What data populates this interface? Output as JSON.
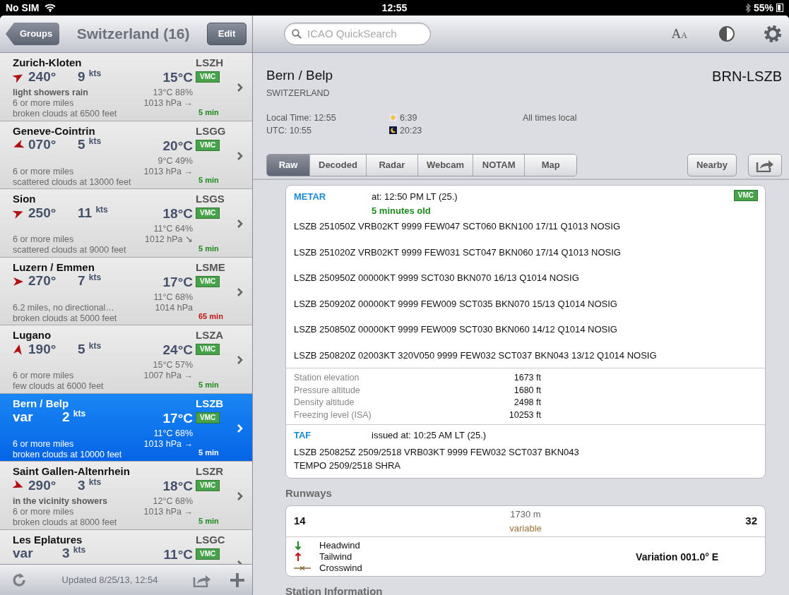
{
  "status_bar": {
    "carrier": "No SIM",
    "time": "12:55",
    "battery": "55%"
  },
  "sidebar": {
    "back_button": "Groups",
    "title": "Switzerland (16)",
    "edit_button": "Edit",
    "stations": [
      {
        "name": "Zurich-Kloten",
        "icao": "LSZH",
        "wind_dir": "240°",
        "speed": "9",
        "speed_unit": "kts",
        "temp": "15°C",
        "flight_rules": "VMC",
        "weather": "light showers rain",
        "dew_humidity": "13°C 88%",
        "visibility": "6 or more miles",
        "pressure": "1013 hPa →",
        "clouds": "broken clouds at 6500 feet",
        "age": "5 min",
        "age_stale": false,
        "selected": false
      },
      {
        "name": "Geneve-Cointrin",
        "icao": "LSGG",
        "wind_dir": "070°",
        "speed": "5",
        "speed_unit": "kts",
        "temp": "20°C",
        "flight_rules": "VMC",
        "dew_humidity": "9°C 49%",
        "visibility": "6 or more miles",
        "pressure": "1013 hPa →",
        "clouds": "scattered clouds at 13000 feet",
        "age": "5 min",
        "age_stale": false,
        "selected": false
      },
      {
        "name": "Sion",
        "icao": "LSGS",
        "wind_dir": "250°",
        "speed": "11",
        "speed_unit": "kts",
        "temp": "18°C",
        "flight_rules": "VMC",
        "dew_humidity": "11°C 64%",
        "visibility": "6 or more miles",
        "pressure": "1012 hPa ↘",
        "clouds": "scattered clouds at 9000 feet",
        "age": "5 min",
        "age_stale": false,
        "selected": false
      },
      {
        "name": "Luzern / Emmen",
        "icao": "LSME",
        "wind_dir": "270°",
        "speed": "7",
        "speed_unit": "kts",
        "temp": "17°C",
        "flight_rules": "VMC",
        "dew_humidity": "11°C 68%",
        "visibility": "6.2 miles, no directional…",
        "pressure": "1014 hPa",
        "clouds": "broken clouds at 5000 feet",
        "age": "65 min",
        "age_stale": true,
        "selected": false
      },
      {
        "name": "Lugano",
        "icao": "LSZA",
        "wind_dir": "190°",
        "speed": "5",
        "speed_unit": "kts",
        "temp": "24°C",
        "flight_rules": "VMC",
        "dew_humidity": "15°C 57%",
        "visibility": "6 or more miles",
        "pressure": "1007 hPa →",
        "clouds": "few clouds at 6000 feet",
        "age": "5 min",
        "age_stale": false,
        "selected": false
      },
      {
        "name": "Bern / Belp",
        "icao": "LSZB",
        "wind_dir": "var",
        "speed": "2",
        "speed_unit": "kts",
        "temp": "17°C",
        "flight_rules": "VMC",
        "dew_humidity": "11°C 68%",
        "visibility": "6 or more miles",
        "pressure": "1013 hPa →",
        "clouds": "broken clouds at 10000 feet",
        "age": "5 min",
        "age_stale": false,
        "selected": true
      },
      {
        "name": "Saint Gallen-Altenrhein",
        "icao": "LSZR",
        "wind_dir": "290°",
        "speed": "3",
        "speed_unit": "kts",
        "temp": "18°C",
        "flight_rules": "VMC",
        "weather": "in the vicinity showers",
        "dew_humidity": "12°C 68%",
        "visibility": "6 or more miles",
        "pressure": "1013 hPa →",
        "clouds": "broken clouds at 8000 feet",
        "age": "5 min",
        "age_stale": false,
        "selected": false
      },
      {
        "name": "Les Eplatures",
        "icao": "LSGC",
        "wind_dir": "var",
        "speed": "3",
        "speed_unit": "kts",
        "temp": "11°C",
        "flight_rules": "VMC",
        "selected": false
      }
    ],
    "updated": "Updated 8/25/13, 12:54"
  },
  "toolbar": {
    "search_placeholder": "ICAO QuickSearch",
    "font_button": {
      "large": "A",
      "small": "A"
    }
  },
  "station": {
    "name": "Bern / Belp",
    "country": "SWITZERLAND",
    "code": "BRN-LSZB",
    "local_time": "Local Time: 12:55",
    "utc": "UTC: 10:55",
    "sunrise": "6:39",
    "sunset": "20:23",
    "times_note": "All times local"
  },
  "tabs": [
    {
      "label": "Raw",
      "selected": true
    },
    {
      "label": "Decoded",
      "selected": false
    },
    {
      "label": "Radar",
      "selected": false
    },
    {
      "label": "Webcam",
      "selected": false
    },
    {
      "label": "NOTAM",
      "selected": false
    },
    {
      "label": "Map",
      "selected": false
    }
  ],
  "nearby_button": "Nearby",
  "metar": {
    "label": "METAR",
    "time": "at: 12:50 PM LT (25.)",
    "age": "5 minutes old",
    "flight_rules": "VMC",
    "reports": [
      "LSZB 251050Z VRB02KT 9999 FEW047 SCT060 BKN100 17/11 Q1013 NOSIG",
      "LSZB 251020Z VRB02KT 9999 FEW031 SCT047 BKN060 17/14 Q1013 NOSIG",
      "LSZB 250950Z 00000KT 9999 SCT030 BKN070 16/13 Q1014 NOSIG",
      "LSZB 250920Z 00000KT 9999 FEW009 SCT035 BKN070 15/13 Q1014 NOSIG",
      "LSZB 250850Z 00000KT 9999 FEW009 SCT030 BKN060 14/12 Q1014 NOSIG",
      "LSZB 250820Z 02003KT 320V050 9999 FEW032 SCT037 BKN043 13/12 Q1014 NOSIG"
    ]
  },
  "altitudes": [
    {
      "label": "Station elevation",
      "value": "1673 ft"
    },
    {
      "label": "Pressure altitude",
      "value": "1680 ft"
    },
    {
      "label": "Density altitude",
      "value": "2498 ft"
    },
    {
      "label": "Freezing level (ISA)",
      "value": "10253 ft"
    }
  ],
  "taf": {
    "label": "TAF",
    "time": "issued at: 10:25 AM LT (25.)",
    "lines": [
      "LSZB 250825Z 2509/2518 VRB03KT 9999 FEW032 SCT037 BKN043",
      "TEMPO 2509/2518 SHRA"
    ]
  },
  "runways": {
    "heading": "Runways",
    "start": "14",
    "length": "1730 m",
    "wind": "variable",
    "end": "32",
    "legend": [
      {
        "kind": "headwind",
        "label": "Headwind"
      },
      {
        "kind": "tailwind",
        "label": "Tailwind"
      },
      {
        "kind": "crosswind",
        "label": "Crosswind"
      }
    ],
    "variation": "Variation 001.0° E"
  },
  "station_info_heading": "Station Information"
}
